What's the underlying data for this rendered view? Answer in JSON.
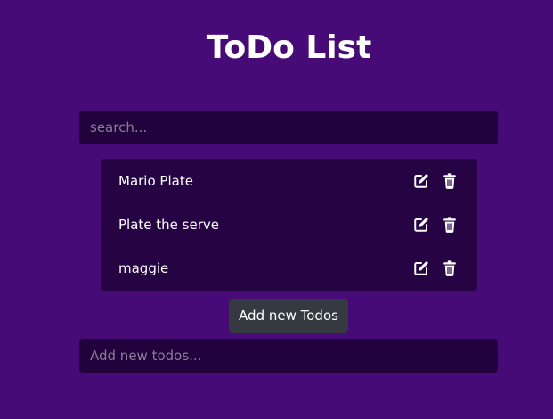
{
  "page": {
    "title": "ToDo List"
  },
  "search": {
    "placeholder": "search...",
    "value": ""
  },
  "todos": [
    {
      "text": "Mario Plate",
      "edit_icon": "edit-icon",
      "delete_icon": "trash-icon"
    },
    {
      "text": "Plate the serve",
      "edit_icon": "edit-icon",
      "delete_icon": "trash-icon"
    },
    {
      "text": "maggie",
      "edit_icon": "edit-icon",
      "delete_icon": "trash-icon"
    }
  ],
  "add": {
    "button_label": "Add new Todos",
    "placeholder": "Add new todos...",
    "value": ""
  },
  "colors": {
    "background": "#470b77",
    "input_bg": "#22023d",
    "list_bg": "#260444",
    "button_bg": "#343a40",
    "text": "#ffffff"
  }
}
